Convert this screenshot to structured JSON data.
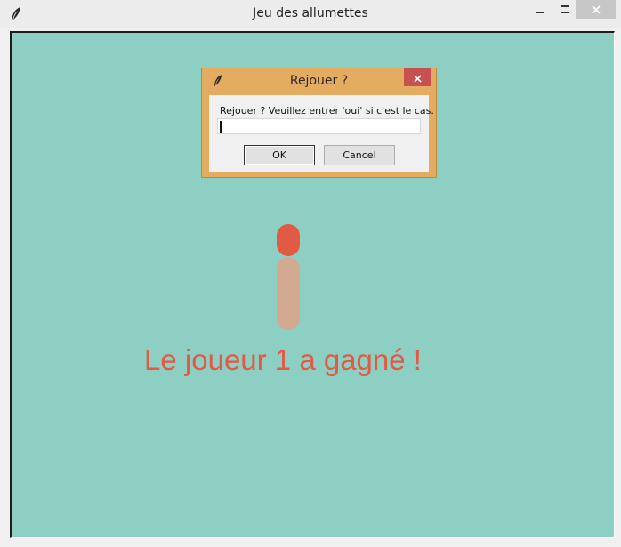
{
  "window": {
    "title": "Jeu des allumettes",
    "icon": "feather-icon",
    "controls": [
      "minimize",
      "maximize",
      "close"
    ]
  },
  "colors": {
    "canvas_background": "#8ecfc4",
    "match_head": "#e05a44",
    "match_stick": "#d3a98f",
    "winner_text": "#e05a44",
    "dialog_frame": "#e3ac61",
    "dialog_close": "#c75050"
  },
  "game": {
    "matches_remaining": 1,
    "winner_message": "Le joueur 1 a gagné !"
  },
  "dialog": {
    "title": "Rejouer ?",
    "icon": "feather-icon",
    "prompt": "Rejouer ? Veuillez entrer 'oui' si c'est le cas.",
    "input_value": "",
    "ok_label": "OK",
    "cancel_label": "Cancel"
  }
}
